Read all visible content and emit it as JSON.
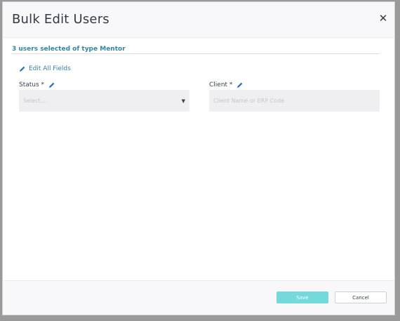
{
  "modal": {
    "title": "Bulk Edit Users",
    "close_icon": "close-icon",
    "selected_info": "3 users selected of type Mentor",
    "edit_all_label": "Edit All Fields"
  },
  "fields": {
    "status": {
      "label": "Status *",
      "placeholder": "Select..."
    },
    "client": {
      "label": "Client *",
      "placeholder": "Client Name or ERP Code"
    }
  },
  "footer": {
    "save_label": "Save",
    "cancel_label": "Cancel"
  },
  "colors": {
    "accent": "#2f86a6",
    "save": "#74d9da"
  }
}
